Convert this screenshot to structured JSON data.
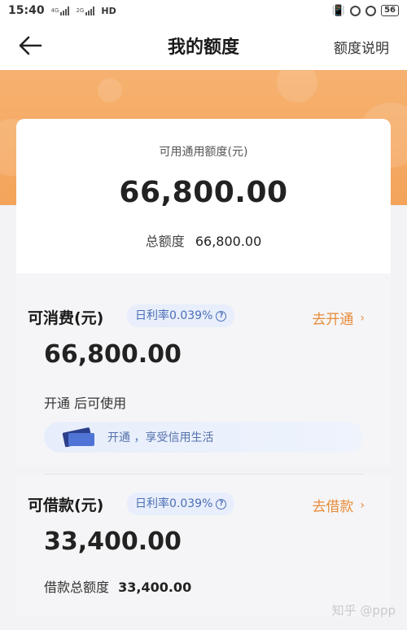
{
  "status_bar": {
    "time": "15:40",
    "network_1": "4G",
    "network_2": "2G",
    "hd_label": "HD",
    "battery": "56"
  },
  "nav": {
    "title": "我的额度",
    "help_link": "额度说明"
  },
  "summary": {
    "label": "可用通用额度(元)",
    "amount": "66,800.00",
    "total_label": "总额度",
    "total_value": "66,800.00"
  },
  "consume": {
    "title": "可消费(元)",
    "rate": "日利率0.039%",
    "action": "去开通",
    "amount": "66,800.00",
    "hint": "开通        后可使用",
    "promo_text": "开通            ，享受信用生活"
  },
  "borrow": {
    "title": "可借款(元)",
    "rate": "日利率0.039%",
    "action": "去借款",
    "amount": "33,400.00",
    "total_label": "借款总额度",
    "total_value": "33,400.00"
  },
  "watermark": "知乎 @ppp",
  "colors": {
    "accent_orange": "#f4a45a",
    "link_orange": "#e88c3a",
    "badge_blue": "#4c6fb5"
  },
  "icons": [
    "back-arrow-icon",
    "info-icon",
    "chevron-right-icon",
    "card-icon",
    "signal-icon",
    "alarm-icon"
  ]
}
